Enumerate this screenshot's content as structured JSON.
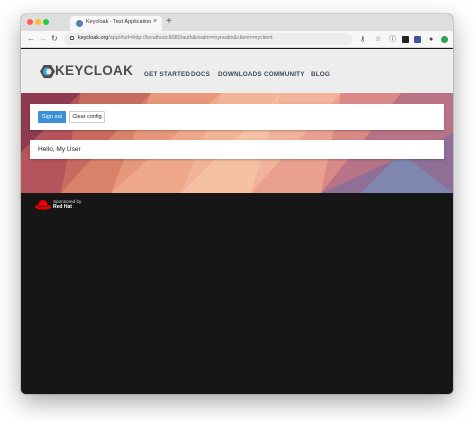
{
  "browser": {
    "tab_title": "Keycloak - Test Application",
    "tab_close": "×",
    "new_tab": "+",
    "url_host": "keycloak.org",
    "url_path": "/app/#url=http://localhost:8080/auth&realm=myrealm&client=myclient"
  },
  "header": {
    "logo_text": "KEYCLOAK",
    "nav": [
      "GET STARTED",
      "DOCS",
      "DOWNLOADS",
      "COMMUNITY",
      "BLOG"
    ]
  },
  "app": {
    "sign_out_label": "Sign out",
    "clear_config_label": "Clear config",
    "greeting": "Hello, My User"
  },
  "footer": {
    "sponsored_text": "Sponsored by",
    "sponsor_name": "Red Hat"
  },
  "colors": {
    "accent": "#3a8fd6",
    "footer_bg": "#161616",
    "nav_text": "#364b5c"
  }
}
